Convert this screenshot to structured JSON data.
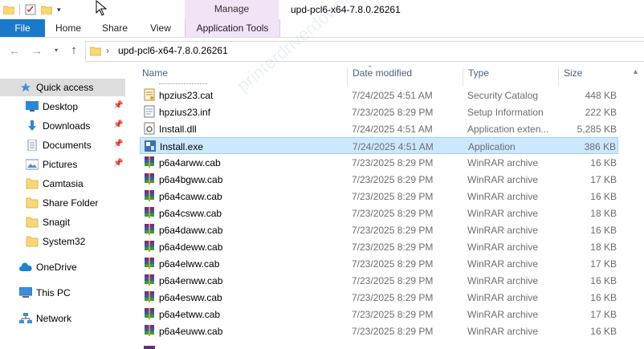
{
  "window": {
    "title": "upd-pcl6-x64-7.8.0.26261",
    "context_tab": "Manage"
  },
  "ribbon": {
    "tabs": [
      "File",
      "Home",
      "Share",
      "View",
      "Application Tools"
    ]
  },
  "address": {
    "path": "upd-pcl6-x64-7.8.0.26261"
  },
  "sidebar": {
    "items": [
      {
        "label": "Quick access",
        "icon": "star-icon",
        "pinned": false,
        "selected": true
      },
      {
        "label": "Desktop",
        "icon": "desktop-icon",
        "pinned": true
      },
      {
        "label": "Downloads",
        "icon": "download-arrow-icon",
        "pinned": true
      },
      {
        "label": "Documents",
        "icon": "documents-icon",
        "pinned": true
      },
      {
        "label": "Pictures",
        "icon": "pictures-icon",
        "pinned": true
      },
      {
        "label": "Camtasia",
        "icon": "folder-icon",
        "pinned": false
      },
      {
        "label": "Share Folder",
        "icon": "folder-icon",
        "pinned": false
      },
      {
        "label": "Snagit",
        "icon": "folder-icon",
        "pinned": false
      },
      {
        "label": "System32",
        "icon": "folder-icon",
        "pinned": false
      },
      {
        "label": "OneDrive",
        "icon": "cloud-icon",
        "pinned": false
      },
      {
        "label": "This PC",
        "icon": "computer-icon",
        "pinned": false
      },
      {
        "label": "Network",
        "icon": "network-icon",
        "pinned": false
      }
    ]
  },
  "columns": {
    "name": "Name",
    "date": "Date modified",
    "type": "Type",
    "size": "Size"
  },
  "files": [
    {
      "name": "hpzius23.cat",
      "date": "7/24/2025 4:51 AM",
      "type": "Security Catalog",
      "size": "448 KB",
      "icon": "catalog-icon"
    },
    {
      "name": "hpzius23.inf",
      "date": "7/23/2025 8:29 PM",
      "type": "Setup Information",
      "size": "222 KB",
      "icon": "inf-icon"
    },
    {
      "name": "Install.dll",
      "date": "7/24/2025 4:51 AM",
      "type": "Application exten...",
      "size": "5,285 KB",
      "icon": "dll-icon"
    },
    {
      "name": "Install.exe",
      "date": "7/24/2025 4:51 AM",
      "type": "Application",
      "size": "386 KB",
      "icon": "exe-icon",
      "selected": true
    },
    {
      "name": "p6a4arww.cab",
      "date": "7/23/2025 8:29 PM",
      "type": "WinRAR archive",
      "size": "16 KB",
      "icon": "winrar-icon"
    },
    {
      "name": "p6a4bgww.cab",
      "date": "7/23/2025 8:29 PM",
      "type": "WinRAR archive",
      "size": "17 KB",
      "icon": "winrar-icon"
    },
    {
      "name": "p6a4caww.cab",
      "date": "7/23/2025 8:29 PM",
      "type": "WinRAR archive",
      "size": "16 KB",
      "icon": "winrar-icon"
    },
    {
      "name": "p6a4csww.cab",
      "date": "7/23/2025 8:29 PM",
      "type": "WinRAR archive",
      "size": "18 KB",
      "icon": "winrar-icon"
    },
    {
      "name": "p6a4daww.cab",
      "date": "7/23/2025 8:29 PM",
      "type": "WinRAR archive",
      "size": "16 KB",
      "icon": "winrar-icon"
    },
    {
      "name": "p6a4deww.cab",
      "date": "7/23/2025 8:29 PM",
      "type": "WinRAR archive",
      "size": "18 KB",
      "icon": "winrar-icon"
    },
    {
      "name": "p6a4elww.cab",
      "date": "7/23/2025 8:29 PM",
      "type": "WinRAR archive",
      "size": "17 KB",
      "icon": "winrar-icon"
    },
    {
      "name": "p6a4enww.cab",
      "date": "7/23/2025 8:29 PM",
      "type": "WinRAR archive",
      "size": "16 KB",
      "icon": "winrar-icon"
    },
    {
      "name": "p6a4esww.cab",
      "date": "7/23/2025 8:29 PM",
      "type": "WinRAR archive",
      "size": "16 KB",
      "icon": "winrar-icon"
    },
    {
      "name": "p6a4etww.cab",
      "date": "7/23/2025 8:29 PM",
      "type": "WinRAR archive",
      "size": "17 KB",
      "icon": "winrar-icon"
    },
    {
      "name": "p6a4euww.cab",
      "date": "7/23/2025 8:29 PM",
      "type": "WinRAR archive",
      "size": "16 KB",
      "icon": "winrar-icon"
    }
  ],
  "colors": {
    "file_tab": "#1979ca",
    "manage_tab": "#f0e4f7",
    "selection": "#cce8ff",
    "selection_border": "#99d1ff",
    "folder": "#f8d775"
  }
}
